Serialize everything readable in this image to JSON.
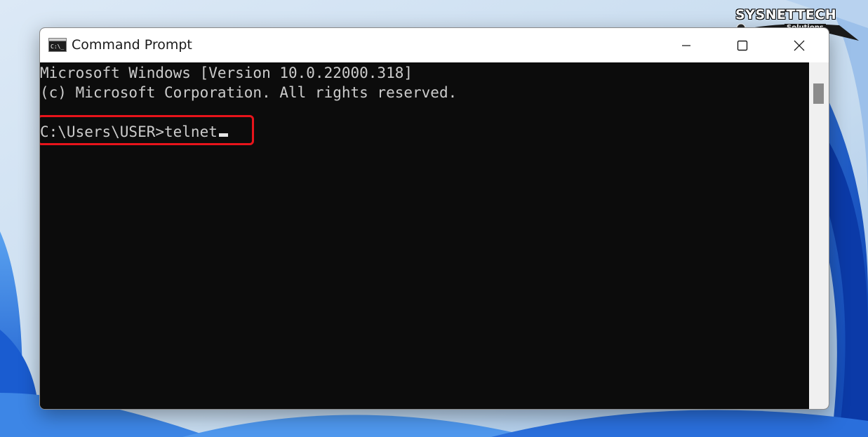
{
  "watermark": {
    "brand": "SYSNETTECH",
    "subtitle": "Solutions"
  },
  "window": {
    "title": "Command Prompt",
    "icon": "cmd-icon",
    "controls": [
      "minimize-icon",
      "maximize-icon",
      "close-icon"
    ]
  },
  "console": {
    "lines": [
      "Microsoft Windows [Version 10.0.22000.318]",
      "(c) Microsoft Corporation. All rights reserved.",
      "",
      "C:\\Users\\USER>telnet"
    ]
  },
  "colors": {
    "console_background": "#0c0c0c",
    "console_text": "#cccccc",
    "highlight": "#e8141b",
    "titlebar": "#ffffff"
  }
}
